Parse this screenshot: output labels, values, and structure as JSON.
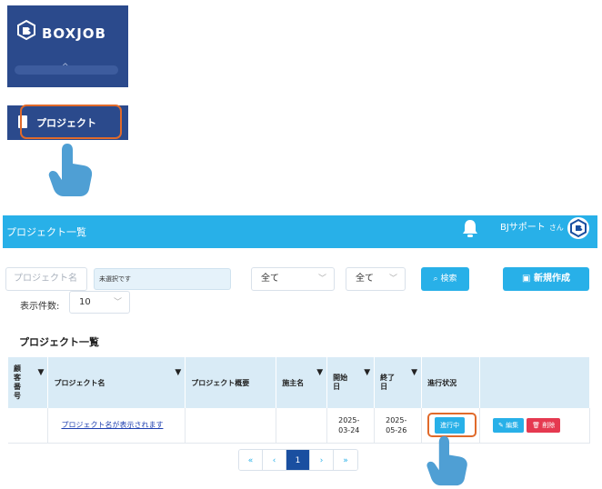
{
  "sidebar": {
    "logo_text": "BOXJOB",
    "collapse_icon": "chevron-up-icon",
    "nav_item_label": "プロジェクト",
    "brand_color": "#2b4a8c",
    "highlight_color": "#e06a2b"
  },
  "header": {
    "title": "プロジェクト一覧",
    "user_name": "BJサポート",
    "user_suffix": "さん",
    "bg_color": "#28b0e8"
  },
  "filters": {
    "project_name_placeholder": "プロジェクト名",
    "unselected_text": "未選択です",
    "select1_value": "全て",
    "select2_value": "全て",
    "search_label": "検索",
    "new_label": "新規作成",
    "count_label": "表示件数:",
    "count_value": "10"
  },
  "section_title": "プロジェクト一覧",
  "table": {
    "headers": [
      "顧客番号",
      "プロジェクト名",
      "プロジェクト概要",
      "施主名",
      "開始日",
      "終了日",
      "進行状況",
      ""
    ],
    "rows": [
      {
        "customer_no": "",
        "project_name": "プロジェクト名が表示されます",
        "summary": "",
        "owner": "",
        "start": "2025-03-24",
        "end": "2025-05-26",
        "status": "進行中",
        "edit_label": "編集",
        "delete_label": "削除"
      }
    ]
  },
  "pagination": {
    "first": "«",
    "prev": "‹",
    "page": "1",
    "next": "›",
    "last": "»"
  }
}
